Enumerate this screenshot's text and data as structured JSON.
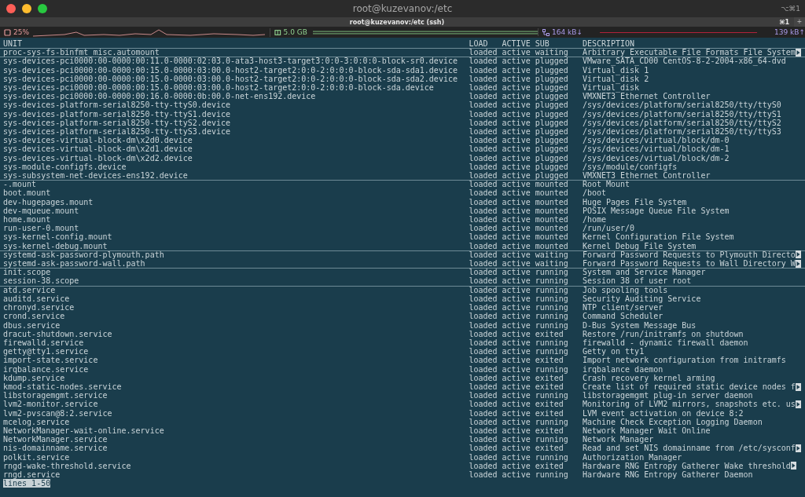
{
  "window": {
    "title": "root@kuzevanov:/etc",
    "shortcut": "⌥⌘1"
  },
  "tabs": [
    {
      "label": "root@kuzevanov:/etc (ssh)",
      "shortcut": "⌘1",
      "selected": true
    }
  ],
  "new_tab": "+",
  "status_bar": {
    "cpu": "25%",
    "memory": "5.0 GB",
    "download": "164 kB↓",
    "upload": "139 kB↑"
  },
  "table": {
    "columns": [
      "UNIT",
      "LOAD",
      "ACTIVE",
      "SUB",
      "DESCRIPTION"
    ],
    "groups": [
      {
        "rows": [
          {
            "unit": "proc-sys-fs-binfmt_misc.automount",
            "load": "loaded",
            "active": "active",
            "sub": "waiting",
            "description": "Arbitrary Executable File Formats File System",
            "truncated": true
          }
        ]
      },
      {
        "rows": [
          {
            "unit": "sys-devices-pci0000:00-0000:00:11.0-0000:02:03.0-ata3-host3-target3:0:0-3:0:0:0-block-sr0.device",
            "load": "loaded",
            "active": "active",
            "sub": "plugged",
            "description": "VMware_SATA_CD00 CentOS-8-2-2004-x86_64-dvd",
            "truncated": false
          },
          {
            "unit": "sys-devices-pci0000:00-0000:00:15.0-0000:03:00.0-host2-target2:0:0-2:0:0:0-block-sda-sda1.device",
            "load": "loaded",
            "active": "active",
            "sub": "plugged",
            "description": "Virtual_disk 1",
            "truncated": false
          },
          {
            "unit": "sys-devices-pci0000:00-0000:00:15.0-0000:03:00.0-host2-target2:0:0-2:0:0:0-block-sda-sda2.device",
            "load": "loaded",
            "active": "active",
            "sub": "plugged",
            "description": "Virtual_disk 2",
            "truncated": false
          },
          {
            "unit": "sys-devices-pci0000:00-0000:00:15.0-0000:03:00.0-host2-target2:0:0-2:0:0:0-block-sda.device",
            "load": "loaded",
            "active": "active",
            "sub": "plugged",
            "description": "Virtual_disk",
            "truncated": false
          },
          {
            "unit": "sys-devices-pci0000:00-0000:00:16.0-0000:0b:00.0-net-ens192.device",
            "load": "loaded",
            "active": "active",
            "sub": "plugged",
            "description": "VMXNET3 Ethernet Controller",
            "truncated": false
          },
          {
            "unit": "sys-devices-platform-serial8250-tty-ttyS0.device",
            "load": "loaded",
            "active": "active",
            "sub": "plugged",
            "description": "/sys/devices/platform/serial8250/tty/ttyS0",
            "truncated": false
          },
          {
            "unit": "sys-devices-platform-serial8250-tty-ttyS1.device",
            "load": "loaded",
            "active": "active",
            "sub": "plugged",
            "description": "/sys/devices/platform/serial8250/tty/ttyS1",
            "truncated": false
          },
          {
            "unit": "sys-devices-platform-serial8250-tty-ttyS2.device",
            "load": "loaded",
            "active": "active",
            "sub": "plugged",
            "description": "/sys/devices/platform/serial8250/tty/ttyS2",
            "truncated": false
          },
          {
            "unit": "sys-devices-platform-serial8250-tty-ttyS3.device",
            "load": "loaded",
            "active": "active",
            "sub": "plugged",
            "description": "/sys/devices/platform/serial8250/tty/ttyS3",
            "truncated": false
          },
          {
            "unit": "sys-devices-virtual-block-dm\\x2d0.device",
            "load": "loaded",
            "active": "active",
            "sub": "plugged",
            "description": "/sys/devices/virtual/block/dm-0",
            "truncated": false
          },
          {
            "unit": "sys-devices-virtual-block-dm\\x2d1.device",
            "load": "loaded",
            "active": "active",
            "sub": "plugged",
            "description": "/sys/devices/virtual/block/dm-1",
            "truncated": false
          },
          {
            "unit": "sys-devices-virtual-block-dm\\x2d2.device",
            "load": "loaded",
            "active": "active",
            "sub": "plugged",
            "description": "/sys/devices/virtual/block/dm-2",
            "truncated": false
          },
          {
            "unit": "sys-module-configfs.device",
            "load": "loaded",
            "active": "active",
            "sub": "plugged",
            "description": "/sys/module/configfs",
            "truncated": false
          },
          {
            "unit": "sys-subsystem-net-devices-ens192.device",
            "load": "loaded",
            "active": "active",
            "sub": "plugged",
            "description": "VMXNET3 Ethernet Controller",
            "truncated": false
          }
        ]
      },
      {
        "rows": [
          {
            "unit": "-.mount",
            "load": "loaded",
            "active": "active",
            "sub": "mounted",
            "description": "Root Mount",
            "truncated": false
          },
          {
            "unit": "boot.mount",
            "load": "loaded",
            "active": "active",
            "sub": "mounted",
            "description": "/boot",
            "truncated": false
          },
          {
            "unit": "dev-hugepages.mount",
            "load": "loaded",
            "active": "active",
            "sub": "mounted",
            "description": "Huge Pages File System",
            "truncated": false
          },
          {
            "unit": "dev-mqueue.mount",
            "load": "loaded",
            "active": "active",
            "sub": "mounted",
            "description": "POSIX Message Queue File System",
            "truncated": false
          },
          {
            "unit": "home.mount",
            "load": "loaded",
            "active": "active",
            "sub": "mounted",
            "description": "/home",
            "truncated": false
          },
          {
            "unit": "run-user-0.mount",
            "load": "loaded",
            "active": "active",
            "sub": "mounted",
            "description": "/run/user/0",
            "truncated": false
          },
          {
            "unit": "sys-kernel-config.mount",
            "load": "loaded",
            "active": "active",
            "sub": "mounted",
            "description": "Kernel Configuration File System",
            "truncated": false
          },
          {
            "unit": "sys-kernel-debug.mount",
            "load": "loaded",
            "active": "active",
            "sub": "mounted",
            "description": "Kernel Debug File System",
            "truncated": false
          }
        ]
      },
      {
        "rows": [
          {
            "unit": "systemd-ask-password-plymouth.path",
            "load": "loaded",
            "active": "active",
            "sub": "waiting",
            "description": "Forward Password Requests to Plymouth Directo",
            "truncated": true
          },
          {
            "unit": "systemd-ask-password-wall.path",
            "load": "loaded",
            "active": "active",
            "sub": "waiting",
            "description": "Forward Password Requests to Wall Directory W",
            "truncated": true
          }
        ]
      },
      {
        "rows": [
          {
            "unit": "init.scope",
            "load": "loaded",
            "active": "active",
            "sub": "running",
            "description": "System and Service Manager",
            "truncated": false
          },
          {
            "unit": "session-38.scope",
            "load": "loaded",
            "active": "active",
            "sub": "running",
            "description": "Session 38 of user root",
            "truncated": false
          }
        ]
      },
      {
        "rows": [
          {
            "unit": "atd.service",
            "load": "loaded",
            "active": "active",
            "sub": "running",
            "description": "Job spooling tools",
            "truncated": false
          },
          {
            "unit": "auditd.service",
            "load": "loaded",
            "active": "active",
            "sub": "running",
            "description": "Security Auditing Service",
            "truncated": false
          },
          {
            "unit": "chronyd.service",
            "load": "loaded",
            "active": "active",
            "sub": "running",
            "description": "NTP client/server",
            "truncated": false
          },
          {
            "unit": "crond.service",
            "load": "loaded",
            "active": "active",
            "sub": "running",
            "description": "Command Scheduler",
            "truncated": false
          },
          {
            "unit": "dbus.service",
            "load": "loaded",
            "active": "active",
            "sub": "running",
            "description": "D-Bus System Message Bus",
            "truncated": false
          },
          {
            "unit": "dracut-shutdown.service",
            "load": "loaded",
            "active": "active",
            "sub": "exited",
            "description": "Restore /run/initramfs on shutdown",
            "truncated": false
          },
          {
            "unit": "firewalld.service",
            "load": "loaded",
            "active": "active",
            "sub": "running",
            "description": "firewalld - dynamic firewall daemon",
            "truncated": false
          },
          {
            "unit": "getty@tty1.service",
            "load": "loaded",
            "active": "active",
            "sub": "running",
            "description": "Getty on tty1",
            "truncated": false
          },
          {
            "unit": "import-state.service",
            "load": "loaded",
            "active": "active",
            "sub": "exited",
            "description": "Import network configuration from initramfs",
            "truncated": false
          },
          {
            "unit": "irqbalance.service",
            "load": "loaded",
            "active": "active",
            "sub": "running",
            "description": "irqbalance daemon",
            "truncated": false
          },
          {
            "unit": "kdump.service",
            "load": "loaded",
            "active": "active",
            "sub": "exited",
            "description": "Crash recovery kernel arming",
            "truncated": false
          },
          {
            "unit": "kmod-static-nodes.service",
            "load": "loaded",
            "active": "active",
            "sub": "exited",
            "description": "Create list of required static device nodes f",
            "truncated": true
          },
          {
            "unit": "libstoragemgmt.service",
            "load": "loaded",
            "active": "active",
            "sub": "running",
            "description": "libstoragemgmt plug-in server daemon",
            "truncated": false
          },
          {
            "unit": "lvm2-monitor.service",
            "load": "loaded",
            "active": "active",
            "sub": "exited",
            "description": "Monitoring of LVM2 mirrors, snapshots etc. us",
            "truncated": true
          },
          {
            "unit": "lvm2-pvscan@8:2.service",
            "load": "loaded",
            "active": "active",
            "sub": "exited",
            "description": "LVM event activation on device 8:2",
            "truncated": false
          },
          {
            "unit": "mcelog.service",
            "load": "loaded",
            "active": "active",
            "sub": "running",
            "description": "Machine Check Exception Logging Daemon",
            "truncated": false
          },
          {
            "unit": "NetworkManager-wait-online.service",
            "load": "loaded",
            "active": "active",
            "sub": "exited",
            "description": "Network Manager Wait Online",
            "truncated": false
          },
          {
            "unit": "NetworkManager.service",
            "load": "loaded",
            "active": "active",
            "sub": "running",
            "description": "Network Manager",
            "truncated": false
          },
          {
            "unit": "nis-domainname.service",
            "load": "loaded",
            "active": "active",
            "sub": "exited",
            "description": "Read and set NIS domainname from /etc/sysconf",
            "truncated": true
          },
          {
            "unit": "polkit.service",
            "load": "loaded",
            "active": "active",
            "sub": "running",
            "description": "Authorization Manager",
            "truncated": false
          },
          {
            "unit": "rngd-wake-threshold.service",
            "load": "loaded",
            "active": "active",
            "sub": "exited",
            "description": "Hardware RNG Entropy Gatherer Wake threshold",
            "truncated": true
          },
          {
            "unit": "rngd.service",
            "load": "loaded",
            "active": "active",
            "sub": "running",
            "description": "Hardware RNG Entropy Gatherer Daemon",
            "truncated": false
          }
        ]
      }
    ]
  },
  "pager_status": "lines 1-50"
}
